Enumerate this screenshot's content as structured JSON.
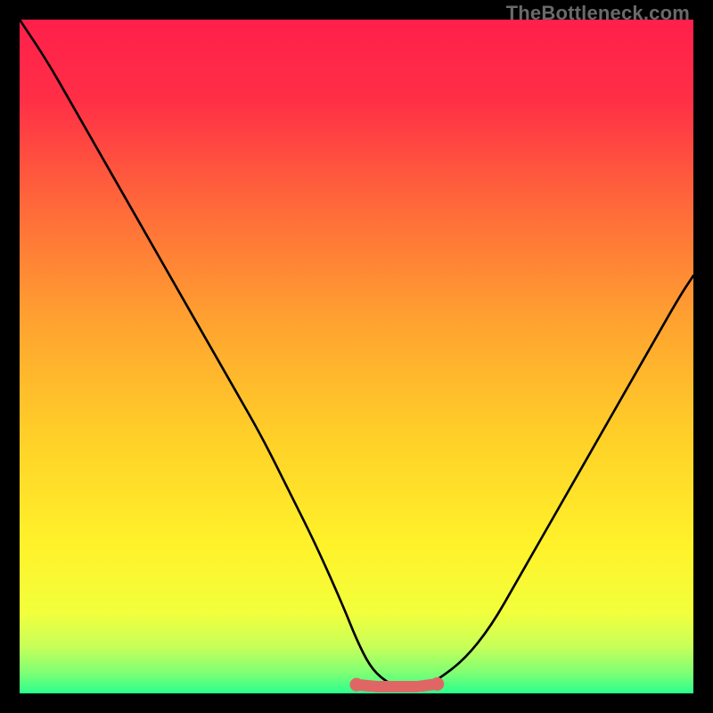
{
  "watermark": "TheBottleneck.com",
  "gradient_stops": [
    {
      "offset": 0.0,
      "color": "#ff1f4b"
    },
    {
      "offset": 0.12,
      "color": "#ff2f46"
    },
    {
      "offset": 0.28,
      "color": "#ff6a3a"
    },
    {
      "offset": 0.45,
      "color": "#ffa330"
    },
    {
      "offset": 0.62,
      "color": "#ffd028"
    },
    {
      "offset": 0.78,
      "color": "#fff22a"
    },
    {
      "offset": 0.88,
      "color": "#f2ff3c"
    },
    {
      "offset": 0.93,
      "color": "#c8ff59"
    },
    {
      "offset": 0.97,
      "color": "#7dff74"
    },
    {
      "offset": 1.0,
      "color": "#2bff8e"
    }
  ],
  "curve_colors": {
    "line": "#000000",
    "marker": "#e06666"
  },
  "chart_data": {
    "type": "line",
    "title": "",
    "xlabel": "",
    "ylabel": "",
    "xlim": [
      0,
      100
    ],
    "ylim": [
      0,
      100
    ],
    "series": [
      {
        "name": "bottleneck-curve",
        "x": [
          0,
          4,
          8,
          12,
          16,
          20,
          24,
          28,
          32,
          36,
          40,
          44,
          48,
          50,
          52,
          54,
          56,
          58,
          60,
          62,
          66,
          70,
          74,
          78,
          82,
          86,
          90,
          94,
          98,
          100
        ],
        "y": [
          100,
          94,
          87,
          80,
          73,
          66,
          59,
          52,
          45,
          38,
          30,
          22,
          13,
          8,
          4,
          2,
          1,
          1,
          1,
          2,
          5,
          10,
          17,
          24,
          31,
          38,
          45,
          52,
          59,
          62
        ]
      }
    ],
    "annotations": [
      {
        "name": "floor-band",
        "x": [
          50,
          53,
          56,
          59,
          62
        ],
        "y": [
          1.3,
          1.0,
          1.0,
          1.0,
          1.4
        ]
      }
    ]
  }
}
